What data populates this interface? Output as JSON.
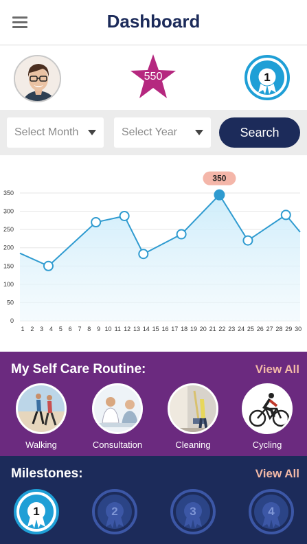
{
  "header": {
    "title": "Dashboard",
    "menu_icon": "hamburger-menu-icon"
  },
  "profile": {
    "avatar_icon": "user-avatar",
    "points": "550",
    "points_color": "#b5287f",
    "current_level": "1"
  },
  "filters": {
    "month_placeholder": "Select Month",
    "year_placeholder": "Select Year",
    "search_label": "Search"
  },
  "chart_data": {
    "type": "area",
    "x": [
      1,
      2,
      3,
      4,
      5,
      6,
      7,
      8,
      9,
      10,
      11,
      12,
      13,
      14,
      15,
      16,
      17,
      18,
      19,
      20,
      21,
      22,
      23,
      24,
      25,
      26,
      27,
      28,
      29,
      30
    ],
    "values": [
      {
        "x": 1,
        "y": 185
      },
      {
        "x": 4,
        "y": 150
      },
      {
        "x": 9,
        "y": 270
      },
      {
        "x": 12,
        "y": 287
      },
      {
        "x": 14,
        "y": 183
      },
      {
        "x": 18,
        "y": 237
      },
      {
        "x": 22,
        "y": 345
      },
      {
        "x": 25,
        "y": 220
      },
      {
        "x": 29,
        "y": 290
      },
      {
        "x": 30.5,
        "y": 243
      }
    ],
    "yticks": [
      "0",
      "50",
      "100",
      "150",
      "200",
      "250",
      "300",
      "350"
    ],
    "xticks": [
      "1",
      "2",
      "3",
      "4",
      "5",
      "6",
      "7",
      "8",
      "9",
      "10",
      "11",
      "12",
      "13",
      "14",
      "15",
      "16",
      "17",
      "18",
      "19",
      "20",
      "21",
      "22",
      "23",
      "24",
      "25",
      "26",
      "27",
      "28",
      "29",
      "30"
    ],
    "ylim": [
      0,
      350
    ],
    "highlight": {
      "x": 22,
      "label": "350"
    },
    "line_color": "#2f9bd0",
    "fill_color": "#c9ebfa",
    "grid": true
  },
  "routine": {
    "title": "My Self Care Routine:",
    "view_all": "View All",
    "view_all_color": "#f2b9a7",
    "items": [
      {
        "label": "Walking",
        "icon": "walking-photo"
      },
      {
        "label": "Consultation",
        "icon": "consultation-photo"
      },
      {
        "label": "Cleaning",
        "icon": "cleaning-photo"
      },
      {
        "label": "Cycling",
        "icon": "cycling-icon"
      }
    ]
  },
  "milestones": {
    "title": "Milestones:",
    "view_all": "View All",
    "view_all_color": "#f2b9a7",
    "items": [
      {
        "number": "1",
        "status": "active"
      },
      {
        "number": "2",
        "status": "locked"
      },
      {
        "number": "3",
        "status": "locked"
      },
      {
        "number": "4",
        "status": "locked"
      }
    ]
  }
}
